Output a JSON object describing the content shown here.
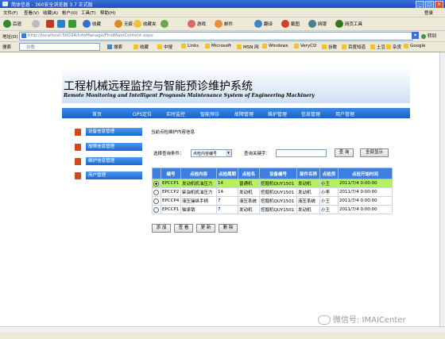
{
  "browser": {
    "title": "简体信息 - 360安全浏览器 3.7 正式版",
    "menu": [
      "文件(F)",
      "查看(V)",
      "收藏(A)",
      "帐户(O)",
      "工具(T)",
      "帮助(H)"
    ],
    "menu_right": "登录",
    "toolbar": [
      "后退",
      "收藏",
      "无痕",
      "收藏夹",
      "游戏",
      "邮件",
      "翻译",
      "截图",
      "网银",
      "网页工具"
    ],
    "address_label": "地址(D)",
    "url": "http://localhost:50034/InfoManage/FindMainContent.aspx",
    "go_label": "转到",
    "search_label": "搜索",
    "search_placeholder": "谷歌",
    "favorites": [
      "收藏",
      "中搜",
      "Links",
      "Microsoft",
      "MSN 网",
      "Windows",
      "VeryCD",
      "谷歌",
      "百度知道",
      "土豆",
      "杂货",
      "Google"
    ]
  },
  "app": {
    "title": "工程机械远程监控与智能预诊维护系统",
    "subtitle": "Remote Monitoring and Intelligent Prognosis Maintenance System of Engineering Machinery",
    "nav": [
      "首页",
      "GPS定位",
      "实时监控",
      "智能预诊",
      "故障管理",
      "维护管理",
      "信息管理",
      "用户管理"
    ]
  },
  "sidebar": [
    "设备信息管理",
    "故障信息管理",
    "维护信息管理",
    "用户管理"
  ],
  "main": {
    "heading": "当前点检维护内容信息",
    "select_label": "选择查询条件：",
    "select_value": "点检内容编号",
    "keyword_label": "查询关键字：",
    "keyword_value": "",
    "query_button": "查 询",
    "show_all_button": "全部显示",
    "columns": [
      "",
      "编号",
      "点检内容",
      "点检周期",
      "点检名",
      "设备编号",
      "部件名称",
      "点检员",
      "点检开始时间"
    ],
    "rows": [
      {
        "selected": true,
        "cells": [
          "EPCCP1",
          "发动机机油压力",
          "14",
          "普通机",
          "挖掘机QUY1501",
          "发动机",
          "小王",
          "2011/7/4 0:00:00"
        ]
      },
      {
        "selected": false,
        "cells": [
          "EPCCP2",
          "柴油机机油压力",
          "14",
          "发动机",
          "挖掘机QUY1501",
          "发动机",
          "小李",
          "2011/7/4 0:00:00"
        ]
      },
      {
        "selected": false,
        "cells": [
          "EPCCP4",
          "液压操纵手柄",
          "7",
          "液压系统",
          "挖掘机QUY1501",
          "液压系统",
          "小王",
          "2011/7/4 0:00:00"
        ]
      },
      {
        "selected": false,
        "cells": [
          "EPCCP1",
          "轴承销",
          "7",
          "发动机",
          "挖掘机QUY1501",
          "发动机",
          "小王",
          "2011/7/4 0:00:00"
        ]
      }
    ],
    "actions": [
      "添 加",
      "查 看",
      "更 新",
      "删 除"
    ]
  },
  "watermark": "微信号: IMAICenter"
}
